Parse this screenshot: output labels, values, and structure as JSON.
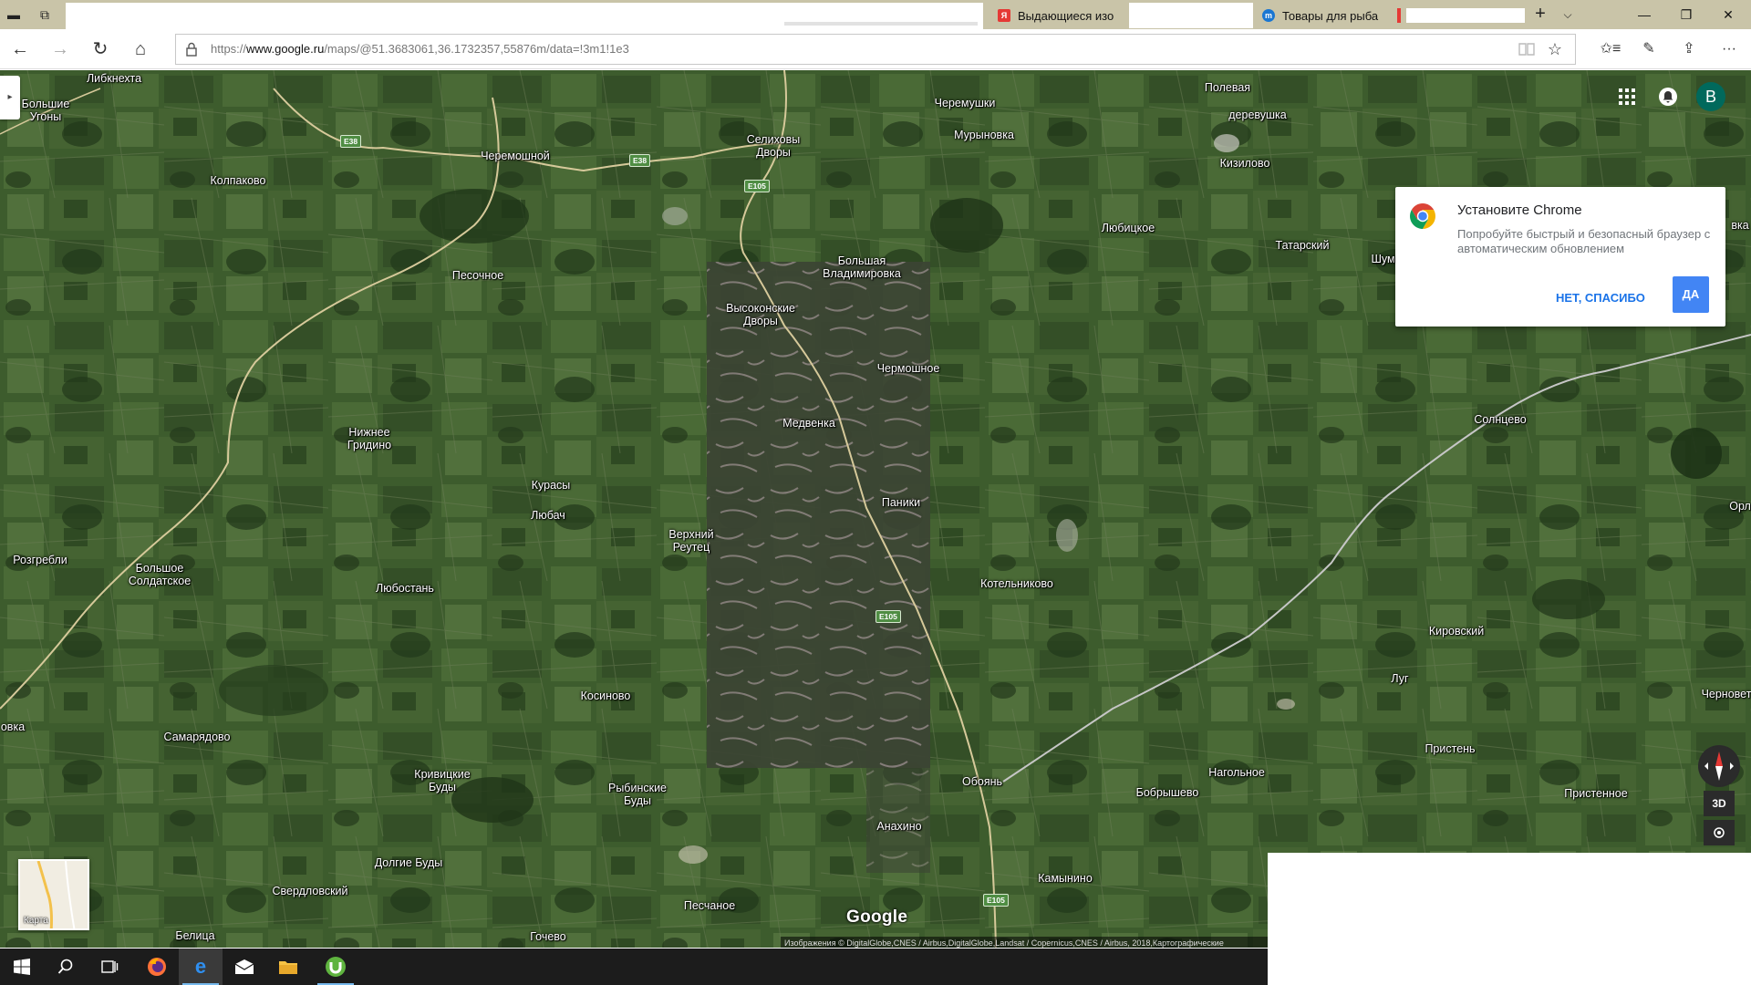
{
  "browser": {
    "tabs": [
      {
        "label": "",
        "active": true
      },
      {
        "label": "Выдающиеся изо",
        "favicon": "yandex-icon",
        "favicon_color": "#e53935"
      },
      {
        "label": "",
        "favicon": ""
      },
      {
        "label": "Товары для рыба",
        "favicon": "shop-icon",
        "favicon_color": "#1976d2"
      },
      {
        "label": "",
        "favicon": "red-bar-icon"
      }
    ],
    "new_tab": "+",
    "tab_list": "⌵",
    "window": {
      "minimize": "—",
      "restore": "❐",
      "close": "✕"
    },
    "nav": {
      "back": "←",
      "forward": "→",
      "refresh": "↻",
      "home": "⌂"
    },
    "url": {
      "prefix": "https://",
      "domain": "www.google.ru",
      "path": "/maps/@51.3683061,36.1732357,55876m/data=!3m1!1e3"
    },
    "toolbar": {
      "favorites": "✩≡",
      "notes": "✎",
      "share": "⇪",
      "more": "···",
      "star": "☆"
    }
  },
  "map": {
    "side_toggle": "▸",
    "avatar_letter": "В",
    "popup": {
      "title": "Установите Chrome",
      "body": "Попробуйте быстрый и безопасный браузер с автоматическим обновлением",
      "no_label": "НЕТ, СПАСИБО",
      "yes_label": "ДА"
    },
    "btn_3d": "3D",
    "minimap_label": "Карта",
    "logo": "Google",
    "attribution": "Изображения © DigitalGlobe,CNES / Airbus,DigitalGlobe,Landsat / Copernicus,CNES / Airbus, 2018,Картографические",
    "places": [
      "Либкнехта",
      "Большие\nУгоны",
      "Колпаково",
      "Черемошной",
      "Селиховы\nДворы",
      "Черемушки",
      "Мурыновка",
      "Полевая",
      "деревушка",
      "Кизилово",
      "Любицкое",
      "Татарский",
      "Шумаково",
      "Песочное",
      "Большая\nВладимировка",
      "Высоконские\nДворы",
      "Чермошное",
      "Медвенка",
      "Нижнее\nГридино",
      "Курасы",
      "Любач",
      "Паники",
      "Верхний\nРеутец",
      "Розгребли",
      "Большое\nСолдатское",
      "Любостань",
      "Котельниково",
      "Солнцево",
      "Кировский",
      "Луг",
      "Косиново",
      "Самарядово",
      "Кривицкие\nБуды",
      "Рыбинские\nБуды",
      "Анахино",
      "Обоянь",
      "Нагольное",
      "Бобрышево",
      "Пристень",
      "Пристенное",
      "Долгие Буды",
      "Свердловский",
      "Песчаное",
      "Камынино",
      "Белица",
      "Гочево",
      "овка",
      "Орл",
      "Черновет",
      "вка"
    ],
    "shields": [
      "E38",
      "E38",
      "E105",
      "E105",
      "E105"
    ]
  },
  "taskbar": {
    "items": [
      "start-icon",
      "search-icon",
      "task-view-icon",
      "firefox-icon",
      "edge-icon",
      "mail-icon",
      "file-explorer-icon",
      "utorrent-icon"
    ]
  }
}
